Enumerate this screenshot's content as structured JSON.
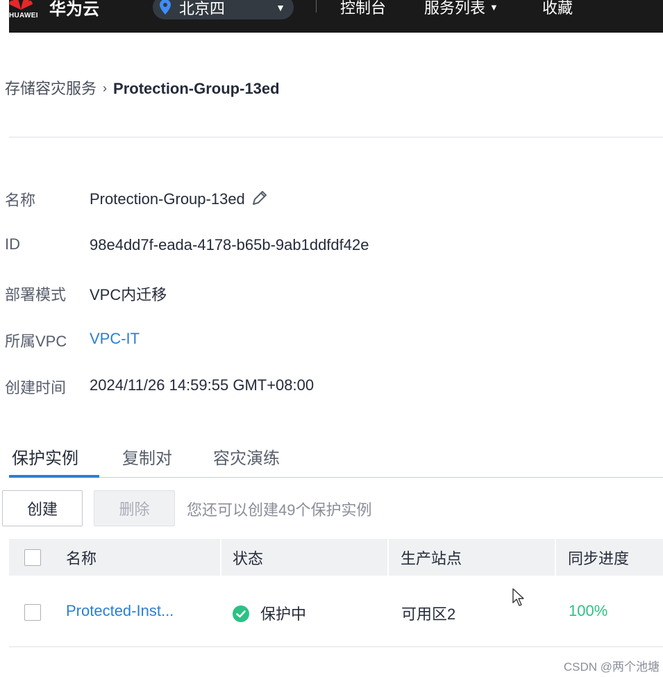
{
  "topbar": {
    "logo_text": "HUAWEI",
    "brand": "华为云",
    "region": "北京四",
    "nav": [
      "控制台",
      "服务列表",
      "收藏"
    ]
  },
  "breadcrumb": {
    "parent": "存储容灾服务",
    "current": "Protection-Group-13ed"
  },
  "details": [
    {
      "label": "名称",
      "value": "Protection-Group-13ed"
    },
    {
      "label": "ID",
      "value": "98e4dd7f-eada-4178-b65b-9ab1ddfdf42e"
    },
    {
      "label": "部署模式",
      "value": "VPC内迁移"
    },
    {
      "label": "所属VPC",
      "value": "VPC-IT"
    },
    {
      "label": "创建时间",
      "value": "2024/11/26 14:59:55 GMT+08:00"
    }
  ],
  "tabs": [
    "保护实例",
    "复制对",
    "容灾演练"
  ],
  "toolbar": {
    "create_label": "创建",
    "delete_label": "删除",
    "quota_text": "您还可以创建49个保护实例"
  },
  "table": {
    "columns": [
      "名称",
      "状态",
      "生产站点",
      "同步进度"
    ],
    "rows": [
      {
        "name": "Protected-Inst...",
        "status": "保护中",
        "site": "可用区2",
        "progress": "100%"
      }
    ]
  },
  "watermark": "CSDN @两个池塘",
  "colors": {
    "topbar_bg": "#1a1a1a",
    "link": "#2a7fd4",
    "success": "#2cc185",
    "tab_active": "#2a7fd4"
  }
}
